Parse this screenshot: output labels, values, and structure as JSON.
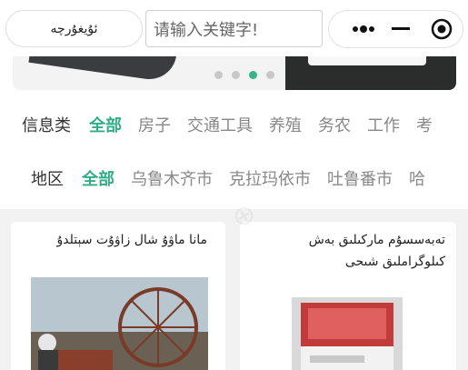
{
  "header": {
    "language_button": "ئۇيغۇرچە",
    "search_placeholder": "请输入关键字!"
  },
  "banner": {
    "dots": 4,
    "active_dot_index": 2,
    "colors": {
      "active_dot": "#35b58d",
      "inactive_dot": "#c8c8c8"
    }
  },
  "filters": {
    "category": {
      "label": "信息类",
      "items": [
        "全部",
        "房子",
        "交通工具",
        "养殖",
        "务农",
        "工作",
        "考"
      ],
      "active": "全部"
    },
    "region": {
      "label": "地区",
      "items": [
        "全部",
        "乌鲁木齐市",
        "克拉玛依市",
        "吐鲁番市",
        "哈"
      ],
      "active": "全部"
    }
  },
  "cards": [
    {
      "title": "مانا ماۋۇ شال زاۋۇت سېتلدۇ"
    },
    {
      "title": "تەبەسسۇم ماركىلىق بەش كىلوگراملىق شىحى"
    }
  ],
  "colors": {
    "accent": "#2fae86"
  }
}
